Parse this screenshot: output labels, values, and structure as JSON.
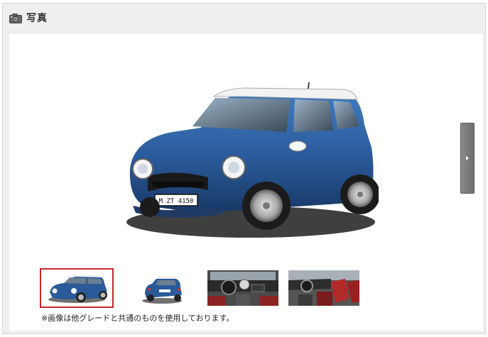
{
  "header": {
    "title": "写真",
    "icon": "camera-icon"
  },
  "main_photo": {
    "plate_text": "M ZT 4150",
    "body_color": "#2a5a9a"
  },
  "navigation": {
    "next_icon": "chevron-right-icon"
  },
  "thumbnails": [
    {
      "name": "exterior-front",
      "selected": true
    },
    {
      "name": "exterior-rear",
      "selected": false
    },
    {
      "name": "interior-dashboard",
      "selected": false
    },
    {
      "name": "interior-seats",
      "selected": false
    }
  ],
  "note": "※画像は他グレードと共通のものを使用しております。",
  "colors": {
    "selected_border": "#c8262b",
    "panel_bg": "#efefef"
  }
}
